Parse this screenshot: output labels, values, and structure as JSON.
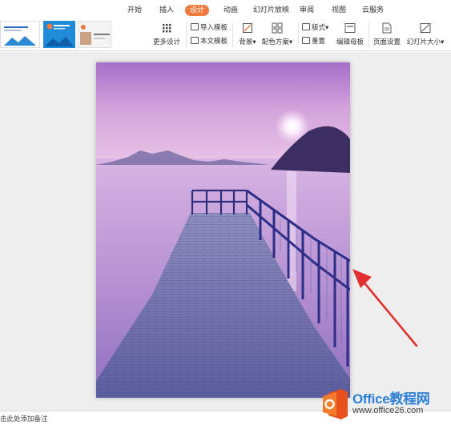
{
  "menu": {
    "tabs": [
      "开始",
      "插入",
      "设计",
      "动画",
      "幻灯片放映",
      "审阅",
      "视图",
      "云服务"
    ],
    "active_tab": "设计"
  },
  "ribbon": {
    "more_design_label": "更多设计",
    "import_template_label": "导入模板",
    "text_template_label": "本文模板",
    "background_label": "背景",
    "color_scheme_label": "配色方案",
    "layout_label": "版式",
    "reset_label": "重置",
    "edit_master_label": "编辑母板",
    "page_setup_label": "页面设置",
    "slide_size_label": "幻灯片大小"
  },
  "status": {
    "notes_placeholder": "击此处添加备注"
  },
  "watermark": {
    "title": "Office教程网",
    "url": "www.office26.com"
  },
  "colors": {
    "accent": "#f07b3f",
    "arrow": "#e03030",
    "brand_blue": "#2c7fd4"
  },
  "icons": [
    "grid-icon",
    "template-icon",
    "background-icon",
    "color-scheme-icon",
    "layout-icon",
    "reset-icon",
    "edit-master-icon",
    "page-setup-icon",
    "slide-size-icon",
    "office-logo-icon"
  ]
}
